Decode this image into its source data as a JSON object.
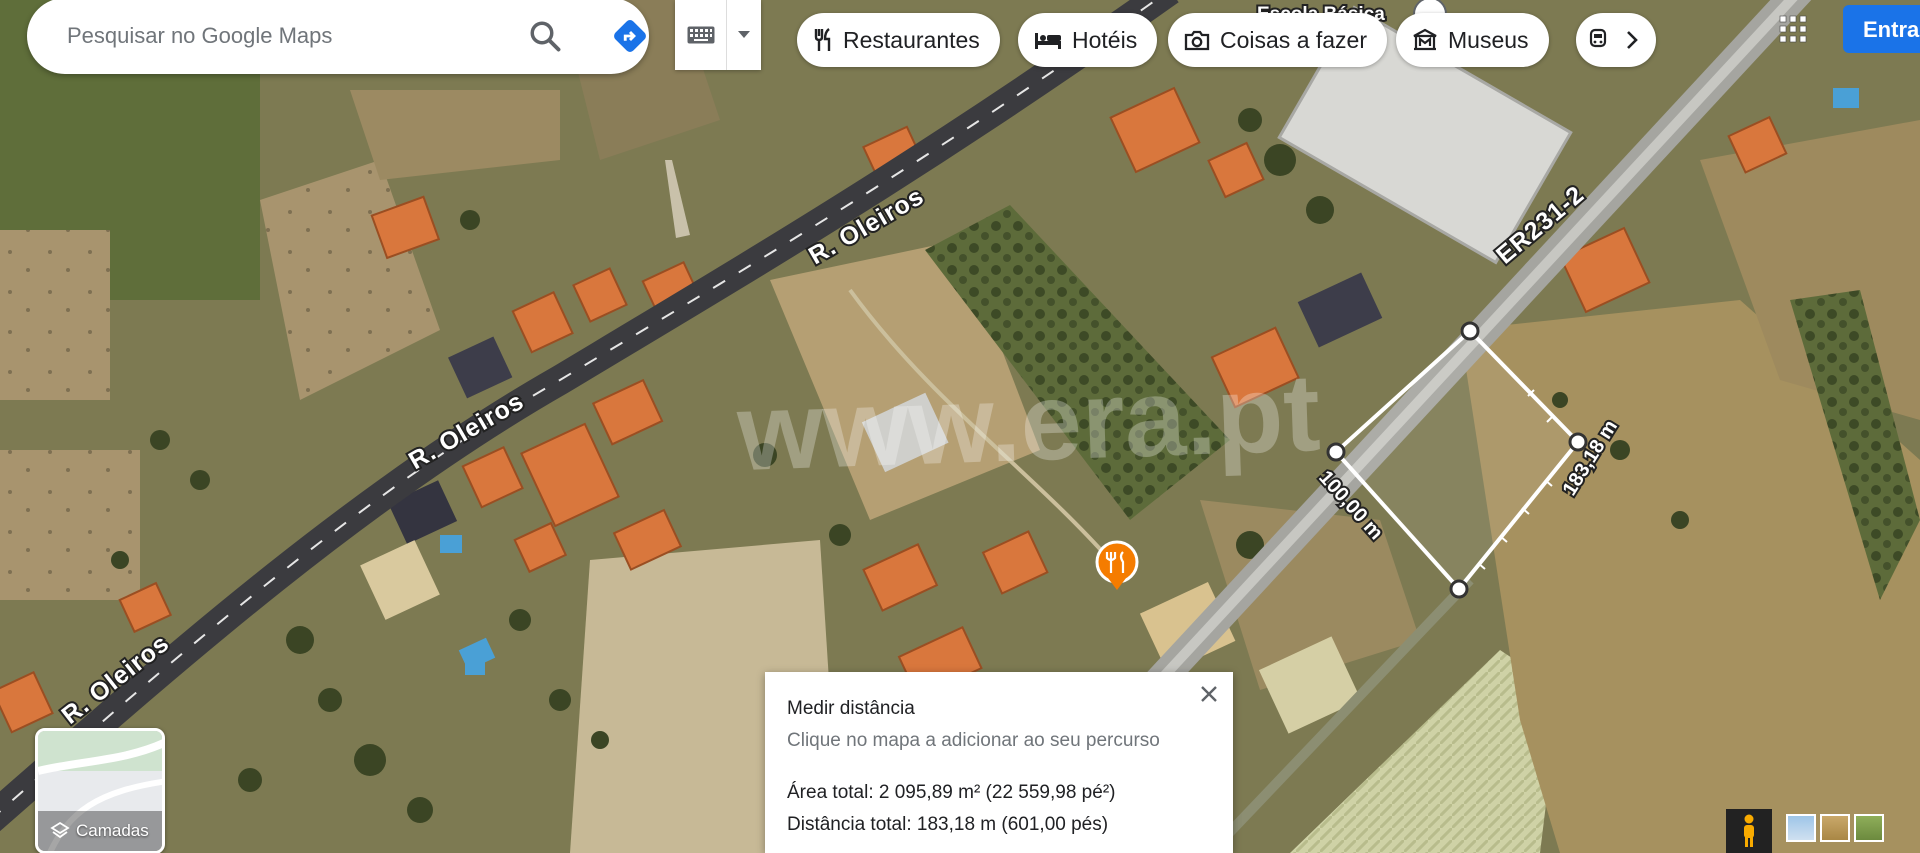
{
  "search": {
    "placeholder": "Pesquisar no Google Maps"
  },
  "chips": [
    {
      "label": "Restaurantes",
      "icon": "fork-knife-icon"
    },
    {
      "label": "Hotéis",
      "icon": "bed-icon"
    },
    {
      "label": "Coisas a fazer",
      "icon": "camera-icon"
    },
    {
      "label": "Museus",
      "icon": "museum-icon"
    }
  ],
  "signin": {
    "label": "Entrar"
  },
  "map": {
    "street_labels": [
      "R. Oleiros",
      "R. Oleiros",
      "R. Oleiros",
      "ER231-2"
    ],
    "poi_label": "Escola Básica",
    "watermark": "www.era.pt",
    "segment_labels": [
      "100,00 m",
      "183,18 m"
    ]
  },
  "layers": {
    "label": "Camadas"
  },
  "measure": {
    "title": "Medir distância",
    "hint": "Clique no mapa a adicionar ao seu percurso",
    "area": "Área total: 2 095,89 m² (22 559,98 pé²)",
    "distance": "Distância total: 183,18 m (601,00 pés)"
  },
  "colors": {
    "accent": "#1a73e8",
    "restaurant_pin": "#f57c00"
  }
}
